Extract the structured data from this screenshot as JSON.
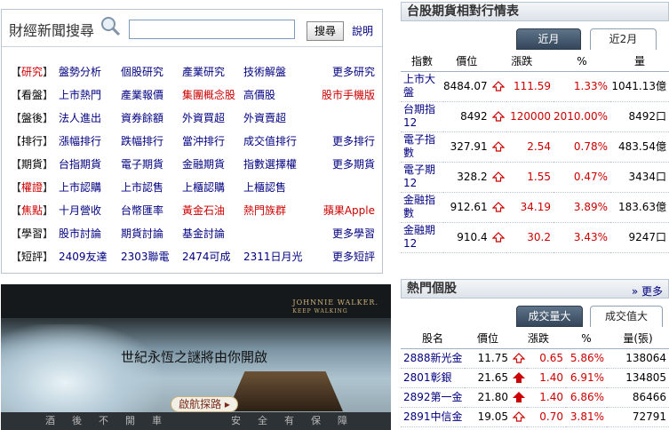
{
  "search": {
    "title": "財經新聞搜尋",
    "button_label": "搜尋",
    "help_label": "說明",
    "input_value": ""
  },
  "menu": [
    {
      "category": "研究",
      "red": true,
      "links": [
        {
          "label": "盤勢分析"
        },
        {
          "label": "個股研究"
        },
        {
          "label": "產業研究"
        },
        {
          "label": "技術解盤"
        }
      ],
      "more": {
        "label": "更多研究",
        "red": false
      }
    },
    {
      "category": "看盤",
      "red": false,
      "links": [
        {
          "label": "上市熱門"
        },
        {
          "label": "產業報價"
        },
        {
          "label": "集團概念股",
          "red": true
        },
        {
          "label": "高價股"
        }
      ],
      "more": {
        "label": "股市手機版",
        "red": true
      }
    },
    {
      "category": "盤後",
      "red": false,
      "links": [
        {
          "label": "法人進出"
        },
        {
          "label": "資券餘額"
        },
        {
          "label": "外資買超"
        },
        {
          "label": "外資賣超"
        }
      ],
      "more": null
    },
    {
      "category": "排行",
      "red": false,
      "links": [
        {
          "label": "漲幅排行"
        },
        {
          "label": "跌幅排行"
        },
        {
          "label": "當沖排行"
        },
        {
          "label": "成交值排行"
        }
      ],
      "more": {
        "label": "更多排行",
        "red": false
      }
    },
    {
      "category": "期貨",
      "red": false,
      "links": [
        {
          "label": "台指期貨"
        },
        {
          "label": "電子期貨"
        },
        {
          "label": "金融期貨"
        },
        {
          "label": "指數選擇權"
        }
      ],
      "more": {
        "label": "更多期貨",
        "red": false
      }
    },
    {
      "category": "權證",
      "red": true,
      "links": [
        {
          "label": "上市認購"
        },
        {
          "label": "上市認售"
        },
        {
          "label": "上櫃認購"
        },
        {
          "label": "上櫃認售"
        }
      ],
      "more": null
    },
    {
      "category": "焦點",
      "red": true,
      "links": [
        {
          "label": "十月營收"
        },
        {
          "label": "台幣匯率"
        },
        {
          "label": "黃金石油",
          "red": true
        },
        {
          "label": "熱門族群",
          "red": true
        }
      ],
      "more": {
        "label": "蘋果Apple",
        "red": true
      }
    },
    {
      "category": "學習",
      "red": false,
      "links": [
        {
          "label": "股市討論"
        },
        {
          "label": "期貨討論"
        },
        {
          "label": "基金討論"
        }
      ],
      "more": {
        "label": "更多學習",
        "red": false
      }
    },
    {
      "category": "短評",
      "red": false,
      "links": [
        {
          "label": "2409友達"
        },
        {
          "label": "2303聯電"
        },
        {
          "label": "2474可成"
        },
        {
          "label": "2311日月光"
        }
      ],
      "more": {
        "label": "更多短評",
        "red": false
      }
    }
  ],
  "ad": {
    "brand": "JOHNNIE WALKER.",
    "brand_sub": "KEEP WALKING",
    "slogan": "世紀永恆之謎將由你開啟",
    "button": "啟航探路",
    "bottom_chars": [
      "酒",
      "後",
      "不",
      "開",
      "車",
      "安",
      "全",
      "有",
      "保",
      "障"
    ]
  },
  "quotes": {
    "title": "台股期貨相對行情表",
    "tabs": [
      "近月",
      "近2月"
    ],
    "headers": [
      "指數",
      "價位",
      "漲跌",
      "%",
      "量"
    ],
    "rows": [
      {
        "name": "上市大盤",
        "price": "8484.07",
        "change": "111.59",
        "pct": "1.33%",
        "volume": "1041.13億"
      },
      {
        "name": "台期指12",
        "price": "8492",
        "change": "120000",
        "pct": "2010.00%",
        "volume": "8492口"
      },
      {
        "name": "電子指數",
        "price": "327.91",
        "change": "2.54",
        "pct": "0.78%",
        "volume": "483.54億"
      },
      {
        "name": "電子期12",
        "price": "328.2",
        "change": "1.55",
        "pct": "0.47%",
        "volume": "3434口"
      },
      {
        "name": "金融指數",
        "price": "912.61",
        "change": "34.19",
        "pct": "3.89%",
        "volume": "183.63億"
      },
      {
        "name": "金融期12",
        "price": "910.4",
        "change": "30.2",
        "pct": "3.43%",
        "volume": "9247口"
      }
    ]
  },
  "hot": {
    "title": "熱門個股",
    "more": "更多",
    "tabs": [
      "成交量大",
      "成交值大"
    ],
    "headers": [
      "股名",
      "價位",
      "漲跌",
      "%",
      "量(張)"
    ],
    "rows": [
      {
        "name": "2888新光金",
        "price": "11.75",
        "change": "0.65",
        "pct": "5.86%",
        "volume": "138064",
        "limit": false
      },
      {
        "name": "2801彰銀",
        "price": "21.65",
        "change": "1.40",
        "pct": "6.91%",
        "volume": "134805",
        "limit": true
      },
      {
        "name": "2892第一金",
        "price": "21.80",
        "change": "1.40",
        "pct": "6.86%",
        "volume": "86466",
        "limit": true
      },
      {
        "name": "2891中信金",
        "price": "19.05",
        "change": "0.70",
        "pct": "3.81%",
        "volume": "72791",
        "limit": false
      }
    ]
  },
  "colors": {
    "up": "#cc0000",
    "link": "#000080",
    "tab_active": "#34465a"
  }
}
